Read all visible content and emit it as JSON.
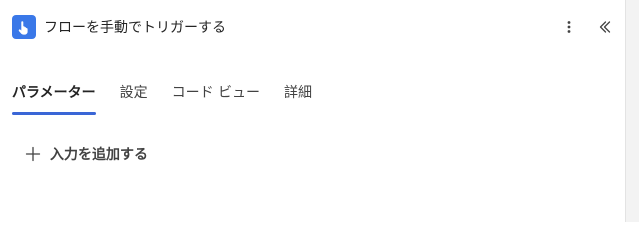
{
  "header": {
    "title": "フローを手動でトリガーする",
    "icon": "hand-tap-icon",
    "icon_color": "#3a78e8"
  },
  "tabs": [
    {
      "label": "パラメーター",
      "active": true
    },
    {
      "label": "設定",
      "active": false
    },
    {
      "label": "コード ビュー",
      "active": false
    },
    {
      "label": "詳細",
      "active": false
    }
  ],
  "actions": {
    "add_input_label": "入力を追加する"
  },
  "colors": {
    "accent": "#3a66d6",
    "text": "#242424"
  }
}
